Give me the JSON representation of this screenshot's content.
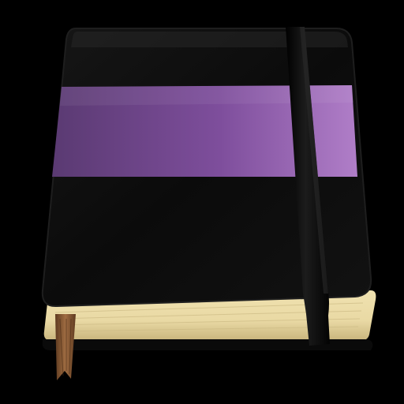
{
  "icon": {
    "name": "notebook-icon",
    "background": "#000000",
    "colors": {
      "cover": "#0b0b0b",
      "cover_edge": "#1e1e1e",
      "band_dark": "#5a3a72",
      "band_light": "#b07ec8",
      "elastic": "#050505",
      "pages": "#f0e2b0",
      "pages_shadow": "#c8b47c",
      "ribbon": "#8a5a35"
    }
  }
}
